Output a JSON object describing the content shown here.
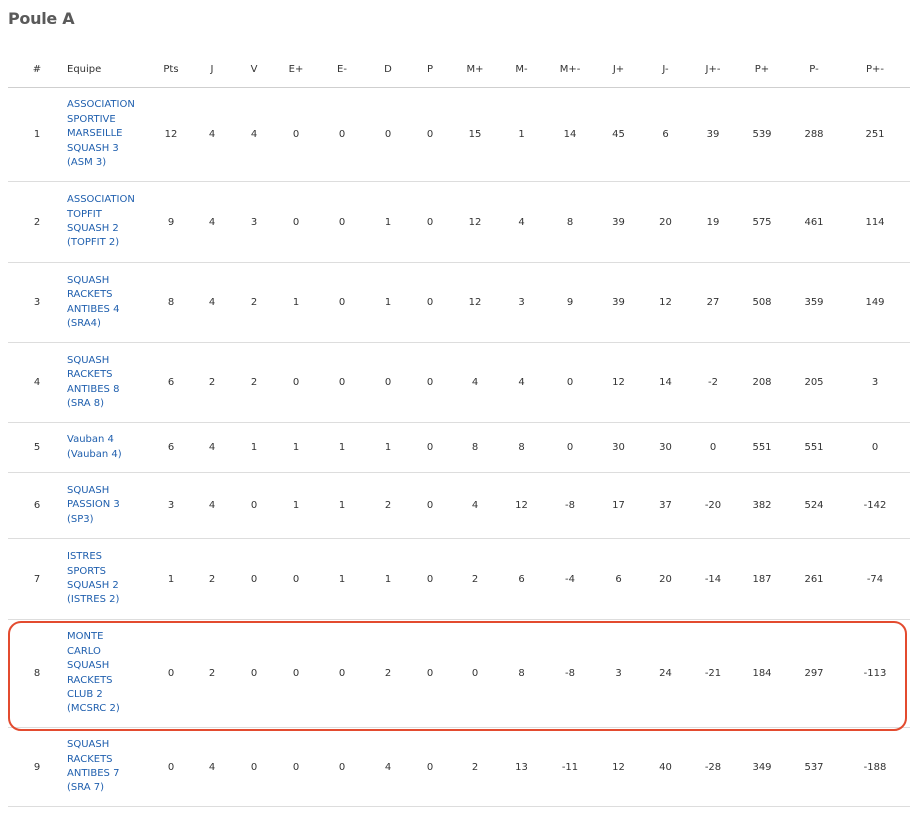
{
  "title": "Poule A",
  "headers": [
    "#",
    "Equipe",
    "Pts",
    "J",
    "V",
    "E+",
    "E-",
    "D",
    "P",
    "M+",
    "M-",
    "M+-",
    "J+",
    "J-",
    "J+-",
    "P+",
    "P-",
    "P+-"
  ],
  "rows": [
    {
      "rank": "1",
      "team": "ASSOCIATION\nSPORTIVE\nMARSEILLE\nSQUASH 3\n(ASM 3)",
      "stats": [
        "12",
        "4",
        "4",
        "0",
        "0",
        "0",
        "0",
        "15",
        "1",
        "14",
        "45",
        "6",
        "39",
        "539",
        "288",
        "251"
      ],
      "highlighted": false
    },
    {
      "rank": "2",
      "team": "ASSOCIATION\nTOPFIT\nSQUASH 2\n(TOPFIT 2)",
      "stats": [
        "9",
        "4",
        "3",
        "0",
        "0",
        "1",
        "0",
        "12",
        "4",
        "8",
        "39",
        "20",
        "19",
        "575",
        "461",
        "114"
      ],
      "highlighted": false
    },
    {
      "rank": "3",
      "team": "SQUASH\nRACKETS\nANTIBES 4\n(SRA4)",
      "stats": [
        "8",
        "4",
        "2",
        "1",
        "0",
        "1",
        "0",
        "12",
        "3",
        "9",
        "39",
        "12",
        "27",
        "508",
        "359",
        "149"
      ],
      "highlighted": false
    },
    {
      "rank": "4",
      "team": "SQUASH\nRACKETS\nANTIBES 8\n(SRA 8)",
      "stats": [
        "6",
        "2",
        "2",
        "0",
        "0",
        "0",
        "0",
        "4",
        "4",
        "0",
        "12",
        "14",
        "-2",
        "208",
        "205",
        "3"
      ],
      "highlighted": false
    },
    {
      "rank": "5",
      "team": "Vauban 4\n(Vauban 4)",
      "stats": [
        "6",
        "4",
        "1",
        "1",
        "1",
        "1",
        "0",
        "8",
        "8",
        "0",
        "30",
        "30",
        "0",
        "551",
        "551",
        "0"
      ],
      "highlighted": false
    },
    {
      "rank": "6",
      "team": "SQUASH\nPASSION 3\n(SP3)",
      "stats": [
        "3",
        "4",
        "0",
        "1",
        "1",
        "2",
        "0",
        "4",
        "12",
        "-8",
        "17",
        "37",
        "-20",
        "382",
        "524",
        "-142"
      ],
      "highlighted": false
    },
    {
      "rank": "7",
      "team": "ISTRES\nSPORTS\nSQUASH 2\n(ISTRES 2)",
      "stats": [
        "1",
        "2",
        "0",
        "0",
        "1",
        "1",
        "0",
        "2",
        "6",
        "-4",
        "6",
        "20",
        "-14",
        "187",
        "261",
        "-74"
      ],
      "highlighted": false
    },
    {
      "rank": "8",
      "team": "MONTE\nCARLO\nSQUASH\nRACKETS\nCLUB 2\n(MCSRC 2)",
      "stats": [
        "0",
        "2",
        "0",
        "0",
        "0",
        "2",
        "0",
        "0",
        "8",
        "-8",
        "3",
        "24",
        "-21",
        "184",
        "297",
        "-113"
      ],
      "highlighted": true
    },
    {
      "rank": "9",
      "team": "SQUASH\nRACKETS\nANTIBES 7\n(SRA 7)",
      "stats": [
        "0",
        "4",
        "0",
        "0",
        "0",
        "4",
        "0",
        "2",
        "13",
        "-11",
        "12",
        "40",
        "-28",
        "349",
        "537",
        "-188"
      ],
      "highlighted": false
    }
  ],
  "colors": {
    "link": "#1f5fae",
    "highlight_border": "#e34b2f",
    "title": "#5a5a5a"
  }
}
